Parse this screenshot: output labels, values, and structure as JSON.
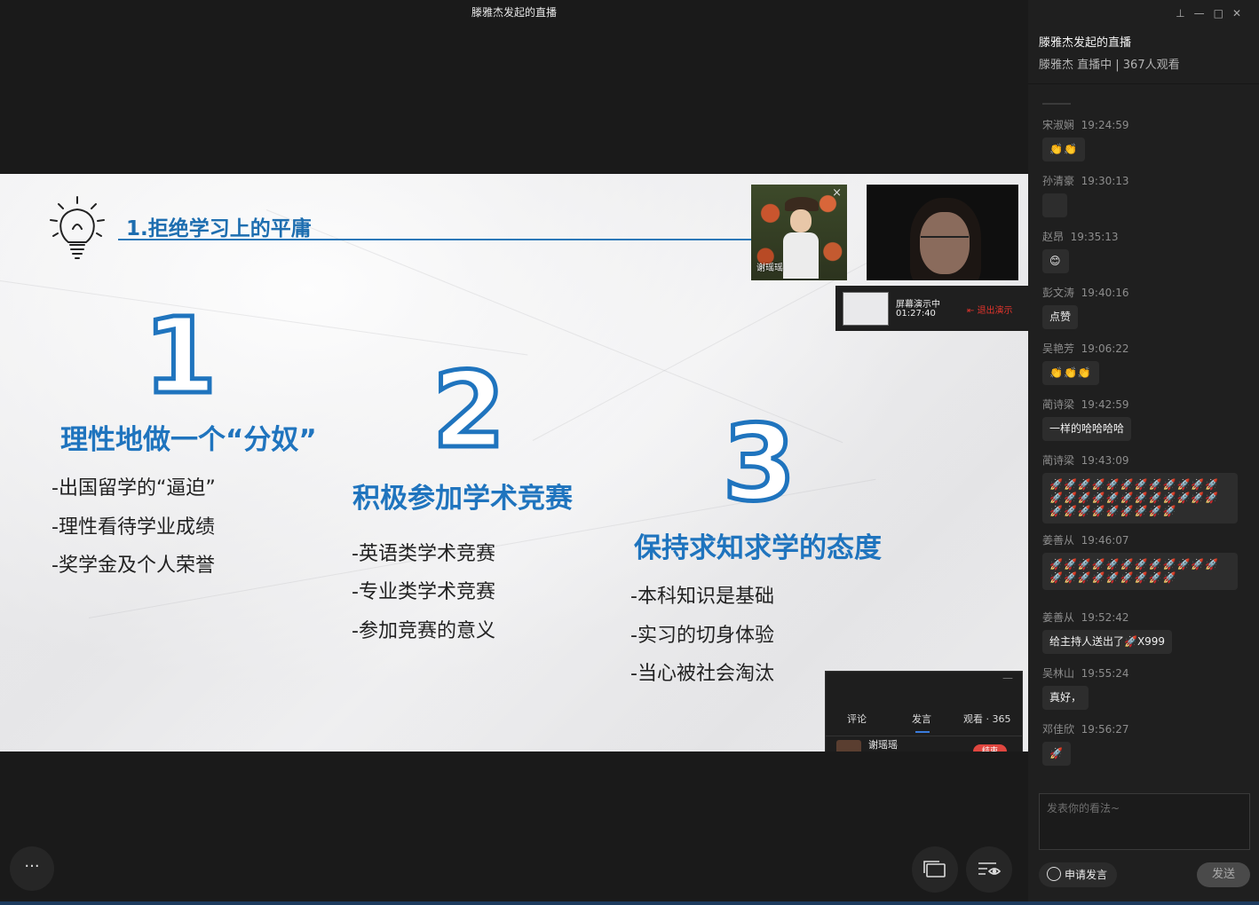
{
  "window": {
    "title": "滕雅杰发起的直播"
  },
  "slide": {
    "title": "1.拒绝学习上的平庸",
    "sections": [
      {
        "number": "1",
        "title": "理性地做一个“分奴”",
        "bullets": [
          "-出国留学的“逼迫”",
          "-理性看待学业成绩",
          "-奖学金及个人荣誉"
        ]
      },
      {
        "number": "2",
        "title": "积极参加学术竞赛",
        "bullets": [
          "-英语类学术竞赛",
          "-专业类学术竞赛",
          "-参加竞赛的意义"
        ]
      },
      {
        "number": "3",
        "title": "保持求知求学的态度",
        "bullets": [
          "-本科知识是基础",
          "-实习的切身体验",
          "-当心被社会淘汰"
        ]
      }
    ],
    "accent_color": "#1f74be"
  },
  "video": {
    "cam1_name": "谢瑶瑶",
    "cam1_close": "×"
  },
  "screenshare": {
    "label": "屏幕演示中",
    "time": "01:27:40",
    "exit_label": "退出演示"
  },
  "popup": {
    "minimize": "—",
    "tab_comment": "评论",
    "tab_speak": "发言",
    "tab_watch": "观看 · 365",
    "user": "谢瑶瑶",
    "button": "结束"
  },
  "controls": {
    "more": "···"
  },
  "sidebar": {
    "title": "滕雅杰发起的直播",
    "subtitle": "滕雅杰 直播中 | 367人观看",
    "messages": [
      {
        "name": "宋淑娴",
        "time": "19:24:59",
        "text": "👏👏"
      },
      {
        "name": "孙清豪",
        "time": "19:30:13",
        "text": ""
      },
      {
        "name": "赵昂",
        "time": "19:35:13",
        "text": "😊"
      },
      {
        "name": "彭文涛",
        "time": "19:40:16",
        "text": "点赞"
      },
      {
        "name": "吴艳芳",
        "time": "19:06:22",
        "text": "👏👏👏"
      },
      {
        "name": "蔺诗梁",
        "time": "19:42:59",
        "text": "一样的哈哈哈哈"
      },
      {
        "name": "蔺诗梁",
        "time": "19:43:09",
        "text": "🚀🚀🚀🚀🚀🚀🚀🚀🚀🚀🚀🚀🚀🚀🚀🚀🚀🚀🚀🚀🚀🚀🚀🚀🚀🚀🚀🚀🚀🚀🚀🚀🚀"
      },
      {
        "name": "姜善从",
        "time": "19:46:07",
        "text": "🚀🚀🚀🚀🚀🚀🚀🚀🚀🚀🚀🚀🚀🚀🚀🚀🚀🚀🚀🚀🚀"
      },
      {
        "name": "姜善从",
        "time": "19:52:42",
        "text": "给主持人送出了🚀X999"
      },
      {
        "name": "吴林山",
        "time": "19:55:24",
        "text": "真好，"
      },
      {
        "name": "邓佳欣",
        "time": "19:56:27",
        "text": "🚀"
      }
    ],
    "input_placeholder": "发表你的看法~",
    "apply_label": "申请发言",
    "send_label": "发送"
  }
}
